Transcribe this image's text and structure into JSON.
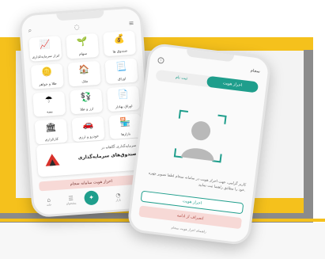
{
  "colors": {
    "accent": "#1f9e8c",
    "yellow": "#f5c11c",
    "pink": "#f7d9d6"
  },
  "left_phone": {
    "top_icons": [
      "search-icon",
      "bell-icon",
      "menu-icon"
    ],
    "tiles": [
      {
        "label": "ابزار سرمایه‌گذاری",
        "icon": "chart-icon",
        "glyph": "📈"
      },
      {
        "label": "سهام",
        "icon": "plant-icon",
        "glyph": "🌱"
      },
      {
        "label": "صندوق ها",
        "icon": "money-bag-icon",
        "glyph": "💰"
      },
      {
        "label": "طلا و جواهر",
        "icon": "gold-icon",
        "glyph": "🪙"
      },
      {
        "label": "ملک",
        "icon": "house-icon",
        "glyph": "🏠"
      },
      {
        "label": "اوراق",
        "icon": "bond-icon",
        "glyph": "📃"
      },
      {
        "label": "بیمه",
        "icon": "umbrella-icon",
        "glyph": "☂"
      },
      {
        "label": "ارز و طلا",
        "icon": "currency-icon",
        "glyph": "💱"
      },
      {
        "label": "اوراق بهادار",
        "icon": "document-icon",
        "glyph": "📄"
      },
      {
        "label": "کارگزاری",
        "icon": "building-icon",
        "glyph": "🏛"
      },
      {
        "label": "خودرو و ارزی",
        "icon": "car-icon",
        "glyph": "🚗"
      },
      {
        "label": "بازارها",
        "icon": "store-icon",
        "glyph": "🏪"
      }
    ],
    "promo": {
      "line1": "سرمایه‌گذاری آگاهانه در",
      "line2": "صندوق‌های سرمایه‌گذاری"
    },
    "banner": "احراز هویت سامانه سجام",
    "tabs": [
      {
        "label": "خانه",
        "glyph": "⌂",
        "icon": "home-icon"
      },
      {
        "label": "پیشخوان",
        "glyph": "☰",
        "icon": "list-icon"
      },
      {
        "label": "",
        "glyph": "✦",
        "icon": "center-icon"
      },
      {
        "label": "بازار",
        "glyph": "◔",
        "icon": "market-icon"
      },
      {
        "label": "پروفایل",
        "glyph": "◉",
        "icon": "profile-icon"
      }
    ]
  },
  "right_phone": {
    "brand": "سجام",
    "info_glyph": "i",
    "segments": [
      "احراز هویت",
      "ثبت نام"
    ],
    "description": "کاربر گرامی، جهت احراز هویت در سامانه سجام لطفا تصویر چهره خود را مطابق راهنما ثبت نمایید.",
    "primary_button": "احراز هویت",
    "secondary_button": "انصراف از ادامه",
    "footer": "راهنمای احراز هویت سجام"
  }
}
